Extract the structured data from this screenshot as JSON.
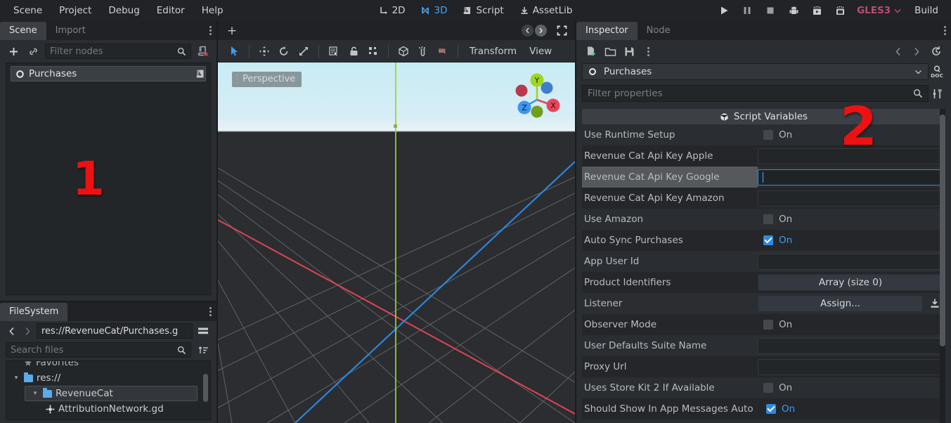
{
  "menu": {
    "items": [
      "Scene",
      "Project",
      "Debug",
      "Editor",
      "Help"
    ],
    "modes": [
      {
        "label": "2D",
        "icon": "2d-icon",
        "active": false
      },
      {
        "label": "3D",
        "icon": "3d-icon",
        "active": true
      },
      {
        "label": "Script",
        "icon": "script-icon",
        "active": false
      },
      {
        "label": "AssetLib",
        "icon": "assetlib-icon",
        "active": false
      }
    ],
    "right": {
      "play": "play-icon",
      "pause": "pause-icon",
      "stop": "stop-icon",
      "android": "android-icon",
      "play_scene": "play-scene-icon",
      "play_custom": "play-custom-scene-icon",
      "renderer": "GLES3",
      "build": "Build"
    }
  },
  "scene_dock": {
    "tabs": [
      {
        "label": "Scene",
        "active": true
      },
      {
        "label": "Import",
        "active": false
      }
    ],
    "toolbar": {
      "add": "add-node-icon",
      "instance": "instance-scene-icon",
      "filter_placeholder": "Filter nodes",
      "filter_value": "",
      "search": "search-icon",
      "remove_script": "remove-script-icon"
    },
    "tree": [
      {
        "label": "Purchases",
        "icon": "node-icon",
        "selected": true,
        "has_script": true
      }
    ],
    "annotation": "1"
  },
  "filesystem_dock": {
    "tabs": [
      {
        "label": "FileSystem",
        "active": true
      }
    ],
    "nav": {
      "back": "back-arrow-icon",
      "forward": "forward-arrow-icon",
      "toggle_split": "toggle-split-mode-icon"
    },
    "path": "res://RevenueCat/Purchases.g",
    "search_placeholder": "Search files",
    "search_value": "",
    "sort_icon": "sort-icon",
    "tree": [
      {
        "label": "Favorites",
        "depth": 0,
        "icon": "favorites-icon",
        "clipped": true
      },
      {
        "label": "res://",
        "depth": 0,
        "icon": "folder-icon",
        "expanded": true
      },
      {
        "label": "RevenueCat",
        "depth": 1,
        "icon": "folder-icon",
        "expanded": true,
        "selected": true
      },
      {
        "label": "AttributionNetwork.gd",
        "depth": 2,
        "icon": "script-file-icon",
        "clipped": true
      }
    ]
  },
  "viewport": {
    "add_tab": "+",
    "nav_prev": "prev-scene-icon",
    "nav_next": "next-scene-icon",
    "fullscreen": "expand-icon",
    "tools": [
      {
        "name": "select-mode-icon",
        "active": true
      },
      {
        "name": "move-mode-icon",
        "active": false
      },
      {
        "name": "rotate-mode-icon",
        "active": false
      },
      {
        "name": "scale-mode-icon",
        "active": false
      },
      {
        "name": "list-select-icon",
        "active": false
      },
      {
        "name": "lock-icon",
        "active": false
      },
      {
        "name": "group-icon",
        "active": false
      },
      {
        "name": "local-space-icon",
        "active": false
      },
      {
        "name": "snap-icon",
        "active": false
      },
      {
        "name": "camera-preview-icon",
        "active": false
      }
    ],
    "menus": [
      "Transform",
      "View"
    ],
    "perspective_label": "Perspective",
    "gizmo": {
      "x": "X",
      "y": "Y",
      "z": "Z",
      "x_color": "#e8445a",
      "y_color": "#8ccf2e",
      "z_color": "#3d95ef"
    }
  },
  "inspector": {
    "tabs": [
      {
        "label": "Inspector",
        "active": true
      },
      {
        "label": "Node",
        "active": false
      }
    ],
    "toolbar": {
      "new_resource": "new-resource-icon",
      "load": "load-resource-icon",
      "save": "save-resource-icon",
      "more": "more-options-icon",
      "history_prev": "history-prev-icon",
      "history_next": "history-next-icon",
      "history": "history-icon"
    },
    "node": {
      "name": "Purchases",
      "icon": "node-icon",
      "chevron": "chevron-down-icon",
      "open_docs": "open-documentation-icon"
    },
    "filter": {
      "placeholder": "Filter properties",
      "value": "",
      "search_icon": "search-icon",
      "tools_icon": "object-tools-icon"
    },
    "section": {
      "label": "Script Variables",
      "icon": "script-variables-icon"
    },
    "properties": [
      {
        "label": "Use Runtime Setup",
        "type": "bool",
        "value": false,
        "value_label": "On"
      },
      {
        "label": "Revenue Cat Api Key Apple",
        "type": "text",
        "value": ""
      },
      {
        "label": "Revenue Cat Api Key Google",
        "type": "text",
        "value": "",
        "selected": true,
        "focused": true
      },
      {
        "label": "Revenue Cat Api Key Amazon",
        "type": "text",
        "value": ""
      },
      {
        "label": "Use Amazon",
        "type": "bool",
        "value": false,
        "value_label": "On"
      },
      {
        "label": "Auto Sync Purchases",
        "type": "bool",
        "value": true,
        "value_label": "On"
      },
      {
        "label": "App User Id",
        "type": "text",
        "value": ""
      },
      {
        "label": "Product Identifiers",
        "type": "button",
        "value_label": "Array (size 0)"
      },
      {
        "label": "Listener",
        "type": "assign",
        "value_label": "Assign...",
        "extra_icon": "load-node-icon"
      },
      {
        "label": "Observer Mode",
        "type": "bool",
        "value": false,
        "value_label": "On"
      },
      {
        "label": "User Defaults Suite Name",
        "type": "text",
        "value": ""
      },
      {
        "label": "Proxy Url",
        "type": "text",
        "value": ""
      },
      {
        "label": "Uses Store Kit 2 If Available",
        "type": "bool",
        "value": false,
        "value_label": "On"
      },
      {
        "label": "Should Show In App Messages Auto",
        "type": "bool",
        "value": true,
        "value_label": "On"
      }
    ],
    "annotation": "2"
  },
  "colors": {
    "accent_blue": "#3d9ef0",
    "annotation_red": "#ee1111",
    "renderer_pink": "#bd4b72",
    "folder_blue": "#5daaea"
  }
}
